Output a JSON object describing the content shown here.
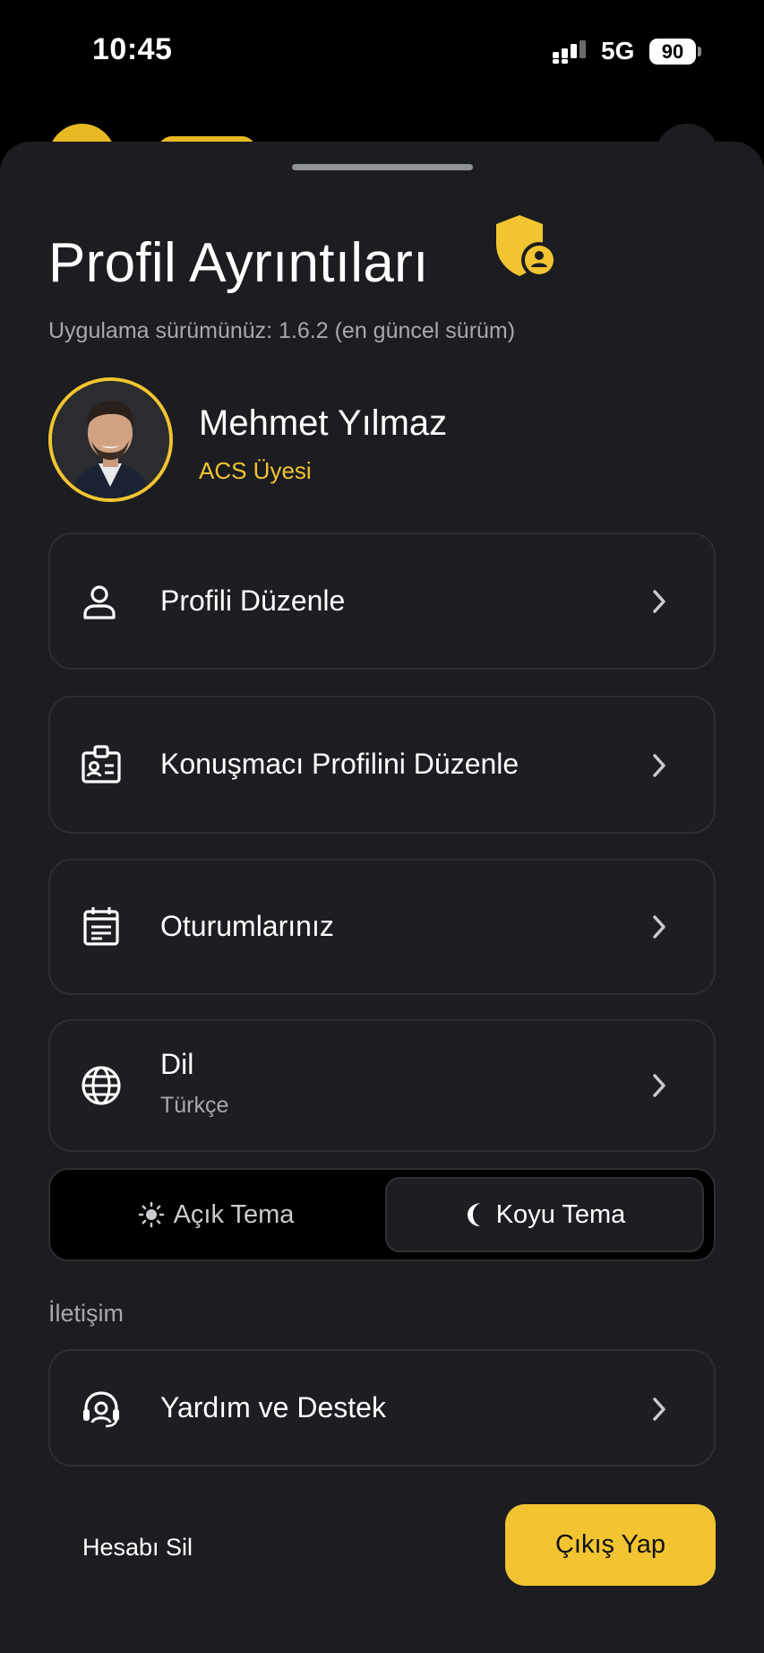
{
  "status_bar": {
    "time": "10:45",
    "network": "5G",
    "battery": "90"
  },
  "header": {
    "title": "Profil Ayrıntıları",
    "version": "Uygulama sürümünüz: 1.6.2 (en güncel sürüm)"
  },
  "user": {
    "name": "Mehmet Yılmaz",
    "role": "ACS Üyesi"
  },
  "menu": {
    "edit_profile": "Profili Düzenle",
    "edit_speaker_profile": "Konuşmacı Profilini Düzenle",
    "sessions": "Oturumlarınız",
    "language": {
      "label": "Dil",
      "value": "Türkçe"
    }
  },
  "theme": {
    "light": "Açık Tema",
    "dark": "Koyu Tema",
    "selected": "dark"
  },
  "contact": {
    "section": "İletişim",
    "help": "Yardım ve Destek"
  },
  "footer": {
    "delete_account": "Hesabı Sil",
    "logout": "Çıkış Yap"
  },
  "colors": {
    "accent": "#f2c431",
    "background": "#1c1d20",
    "card_border": "#2c2e32"
  }
}
